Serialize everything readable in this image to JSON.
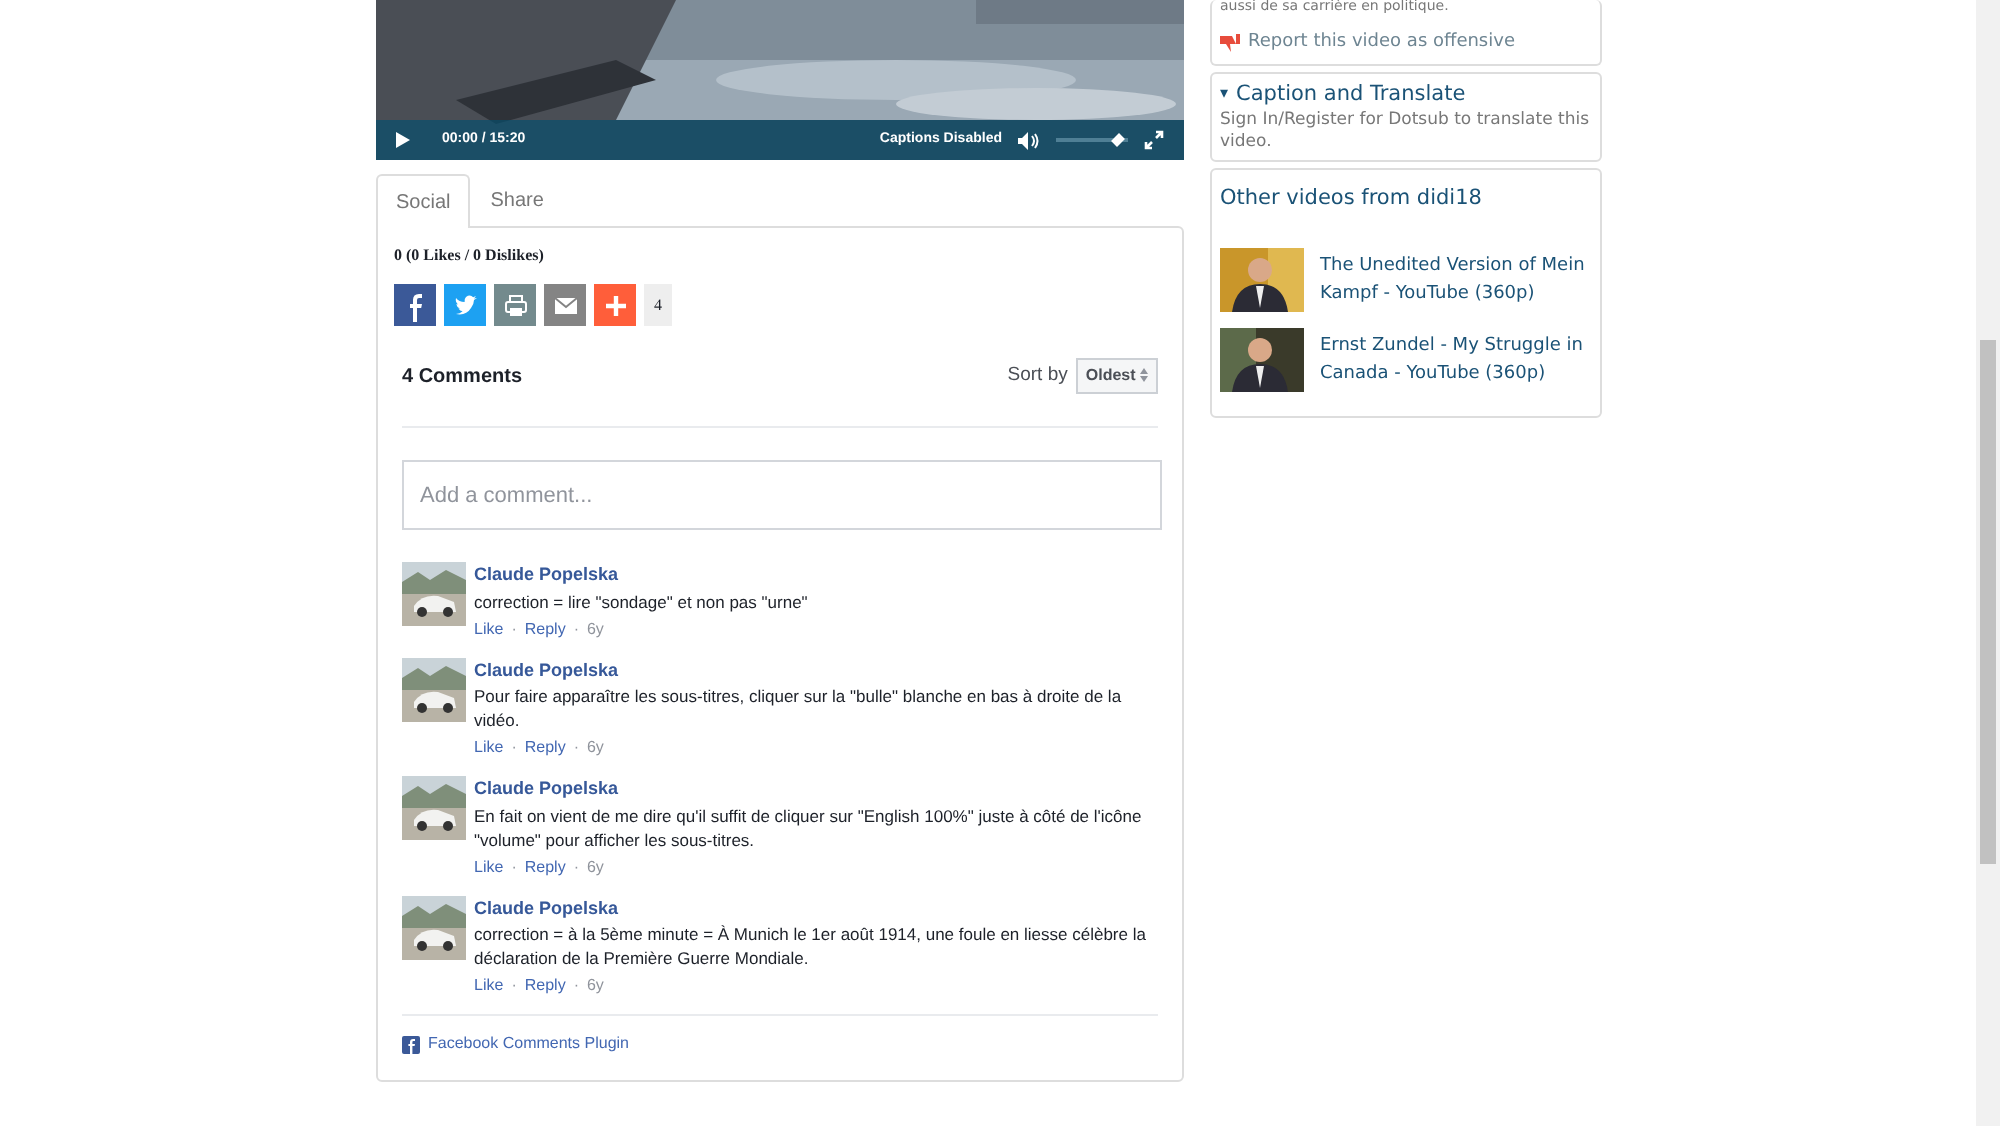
{
  "video": {
    "time": "00:00 / 15:20",
    "captions": "Captions Disabled",
    "volume": {
      "level": 0.85
    }
  },
  "tabs": [
    {
      "label": "Social",
      "selected": true
    },
    {
      "label": "Share",
      "selected": false
    }
  ],
  "rating": "0 (0 Likes / 0 Dislikes)",
  "share_buttons": [
    {
      "kind": "facebook"
    },
    {
      "kind": "twitter"
    },
    {
      "kind": "print"
    },
    {
      "kind": "email"
    },
    {
      "kind": "more"
    }
  ],
  "share_count": "4",
  "comments_header": {
    "count": "4 Comments",
    "sort_label": "Sort by",
    "sort_value": "Oldest"
  },
  "comment_box": {
    "placeholder": "Add a comment..."
  },
  "action_separator": "·",
  "comments": [
    {
      "author": "Claude Popelska",
      "text": "correction = lire \"sondage\" et non pas \"urne\"",
      "actions": [
        "Like",
        "Reply",
        "6y"
      ]
    },
    {
      "author": "Claude Popelska",
      "text": "Pour faire apparaître les sous-titres, cliquer sur la \"bulle\" blanche en bas à droite de la vidéo.",
      "actions": [
        "Like",
        "Reply",
        "6y"
      ]
    },
    {
      "author": "Claude Popelska",
      "text": "En fait on vient de me dire qu'il suffit de cliquer sur \"English 100%\" juste à côté de l'icône \"volume\" pour afficher les sous-titres.",
      "actions": [
        "Like",
        "Reply",
        "6y"
      ]
    },
    {
      "author": "Claude Popelska",
      "text": "correction = à la 5ème minute = À Munich le 1er août 1914, une foule en liesse célèbre la déclaration de la Première Guerre Mondiale.",
      "actions": [
        "Like",
        "Reply",
        "6y"
      ]
    }
  ],
  "plugin_footer": "Facebook Comments Plugin",
  "sidebar": {
    "cut_text": "aussi de sa carrière en politique.",
    "report": "Report this video as offensive",
    "caption_panel": {
      "toggle": "▾",
      "title": "Caption and Translate",
      "text": "Sign In/Register for Dotsub to translate this video."
    },
    "other_videos": {
      "title": "Other videos from didi18",
      "items": [
        {
          "title": "The Unedited Version of Mein Kampf - YouTube (360p)"
        },
        {
          "title": "Ernst Zundel - My Struggle in Canada - YouTube (360p)"
        }
      ]
    }
  }
}
